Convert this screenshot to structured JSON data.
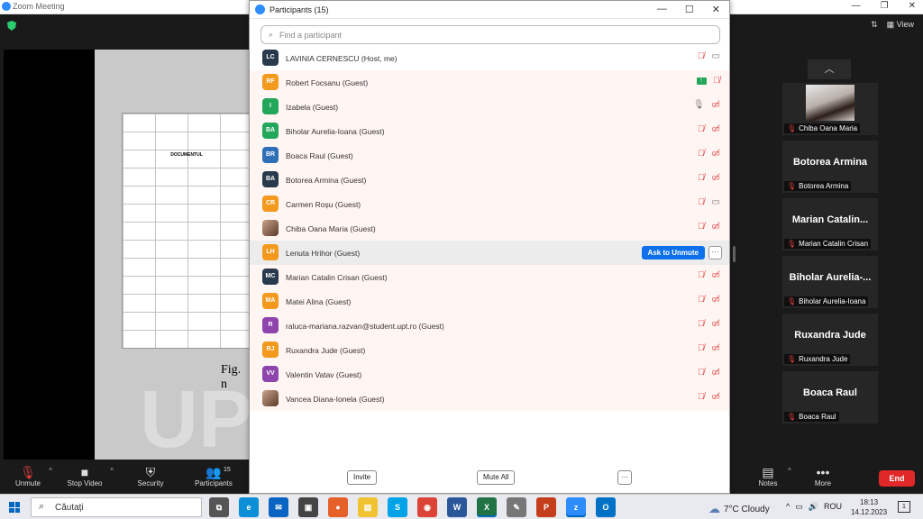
{
  "window": {
    "title": "Zoom Meeting"
  },
  "top_right": {
    "view_label": "View"
  },
  "shared_screen": {
    "doc_header": "DOCUMENTUL",
    "fig_caption": "Fig. n"
  },
  "gallery": [
    {
      "big": "",
      "label": "Chiba Oana Maria",
      "photo": true
    },
    {
      "big": "Botorea Armina",
      "label": "Botorea Armina"
    },
    {
      "big": "Marian Catalin...",
      "label": "Marian Catalin Crisan"
    },
    {
      "big": "Biholar Aurelia-...",
      "label": "Biholar Aurelia-Ioana"
    },
    {
      "big": "Ruxandra Jude",
      "label": "Ruxandra Jude"
    },
    {
      "big": "Boaca Raul",
      "label": "Boaca Raul"
    }
  ],
  "toolbar": {
    "unmute": "Unmute",
    "stop_video": "Stop Video",
    "security": "Security",
    "participants": "Participants",
    "participants_count": "15",
    "notes": "Notes",
    "more": "More",
    "end": "End"
  },
  "panel": {
    "title": "Participants (15)",
    "search_placeholder": "Find a participant",
    "ask_to_unmute": "Ask to Unmute",
    "invite": "Invite",
    "mute_all": "Mute All",
    "participants": [
      {
        "initials": "LC",
        "name": "LAVINIA CERNESCU (Host, me)",
        "color": "#2a3a4d",
        "mic": "off",
        "cam": "on"
      },
      {
        "initials": "RF",
        "name": "Robert Focsanu (Guest)",
        "color": "#f39a1e",
        "mic": "off",
        "cam": "share"
      },
      {
        "initials": "I",
        "name": "Izabela (Guest)",
        "color": "#23a75a",
        "mic": "on",
        "cam": "off"
      },
      {
        "initials": "BA",
        "name": "Biholar Aurelia-Ioana (Guest)",
        "color": "#23a75a",
        "mic": "off",
        "cam": "off"
      },
      {
        "initials": "BR",
        "name": "Boaca Raul (Guest)",
        "color": "#2f6fb7",
        "mic": "off",
        "cam": "off"
      },
      {
        "initials": "BA",
        "name": "Botorea Armina (Guest)",
        "color": "#2a3a4d",
        "mic": "off",
        "cam": "off"
      },
      {
        "initials": "CR",
        "name": "Carmen Roșu (Guest)",
        "color": "#f39a1e",
        "mic": "off",
        "cam": "on"
      },
      {
        "initials": "",
        "name": "Chiba Oana Maria (Guest)",
        "color": "",
        "mic": "off",
        "cam": "off",
        "photo": true
      },
      {
        "initials": "LH",
        "name": "Lenuta Hrihor (Guest)",
        "color": "#f39a1e",
        "hover": true
      },
      {
        "initials": "MC",
        "name": "Marian Catalin Crisan (Guest)",
        "color": "#2a3a4d",
        "mic": "off",
        "cam": "off"
      },
      {
        "initials": "MA",
        "name": "Matei Alina (Guest)",
        "color": "#f39a1e",
        "mic": "off",
        "cam": "off"
      },
      {
        "initials": "R",
        "name": "raluca-mariana.razvan@student.upt.ro (Guest)",
        "color": "#8e44ad",
        "mic": "off",
        "cam": "off"
      },
      {
        "initials": "RJ",
        "name": "Ruxandra Jude (Guest)",
        "color": "#f39a1e",
        "mic": "off",
        "cam": "off"
      },
      {
        "initials": "VV",
        "name": "Valentin Vatav (Guest)",
        "color": "#8e44ad",
        "mic": "off",
        "cam": "off"
      },
      {
        "initials": "",
        "name": "Vancea Diana-Ionela (Guest)",
        "color": "",
        "mic": "off",
        "cam": "off",
        "photo": true
      }
    ]
  },
  "taskbar": {
    "search_text": "Căutați",
    "weather": "7°C  Cloudy",
    "lang": "ROU",
    "time": "18:13",
    "date": "14.12.2023",
    "notif_count": "1",
    "apps": [
      {
        "name": "task-view",
        "label": "⧉",
        "color": "#555"
      },
      {
        "name": "edge",
        "label": "e",
        "color": "#0c8fd6"
      },
      {
        "name": "mail",
        "label": "✉",
        "color": "#0a64c2"
      },
      {
        "name": "store",
        "label": "▣",
        "color": "#444"
      },
      {
        "name": "firefox",
        "label": "●",
        "color": "#e6602a"
      },
      {
        "name": "explorer",
        "label": "▤",
        "color": "#f1c232"
      },
      {
        "name": "skype",
        "label": "S",
        "color": "#00a2e8"
      },
      {
        "name": "chrome",
        "label": "◉",
        "color": "#db4437"
      },
      {
        "name": "word",
        "label": "W",
        "color": "#2b579a"
      },
      {
        "name": "excel",
        "label": "X",
        "color": "#217346"
      },
      {
        "name": "paint",
        "label": "✎",
        "color": "#777"
      },
      {
        "name": "powerpoint",
        "label": "P",
        "color": "#c43e1c"
      },
      {
        "name": "zoom",
        "label": "z",
        "color": "#2d8cff"
      },
      {
        "name": "outlook",
        "label": "O",
        "color": "#0072c6"
      }
    ]
  }
}
